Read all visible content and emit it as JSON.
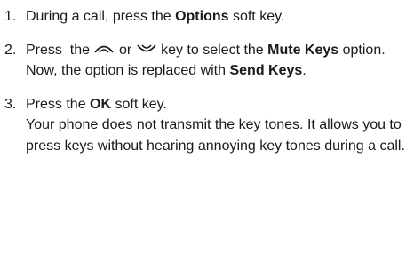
{
  "steps": [
    {
      "number": "1.",
      "text_before": "During a call, press the ",
      "bold": "Options",
      "text_after": " soft key."
    },
    {
      "number": "2.",
      "press": "Press  the",
      "up_icon": "up-arrow-key-icon",
      "or": "or",
      "down_icon": "down-arrow-key-icon",
      "text_mid": "key to select the ",
      "bold1": "Mute Keys",
      "text_mid2": " option. Now, the option is replaced with ",
      "bold2": "Send Keys",
      "text_end": "."
    },
    {
      "number": "3.",
      "text_before": "Press the ",
      "bold": "OK",
      "text_after": " soft key.",
      "description": "Your phone does not transmit the key tones. It allows you to press keys without hearing annoying key tones during a call."
    }
  ]
}
